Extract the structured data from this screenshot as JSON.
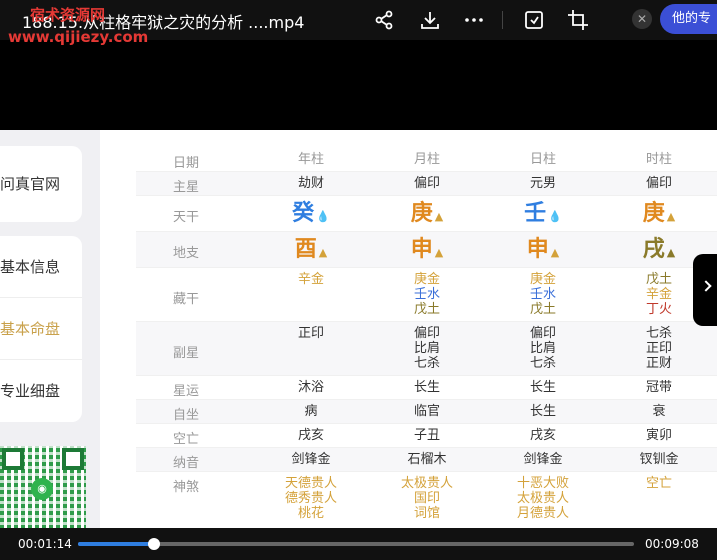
{
  "header": {
    "title": "188.15.从柱格牢狱之灾的分析 ....mp4",
    "watermark_cn": "宿术资源网",
    "watermark_url": "www.qijiezy.com",
    "his_label": "他的专"
  },
  "sidebar": {
    "card1": "问真官网",
    "card2_items": [
      "基本信息",
      "基本命盘",
      "专业细盘"
    ],
    "qr_icon": "wechat-icon"
  },
  "table": {
    "columns": [
      "日期",
      "年柱",
      "月柱",
      "日柱",
      "时柱"
    ],
    "zhuxing": {
      "label": "主星",
      "values": [
        "劫财",
        "偏印",
        "元男",
        "偏印"
      ]
    },
    "tiangan": {
      "label": "天干",
      "values": [
        "癸",
        "庚",
        "壬",
        "庚"
      ]
    },
    "dizhi": {
      "label": "地支",
      "values": [
        "酉",
        "申",
        "申",
        "戌"
      ]
    },
    "canggan": {
      "label": "藏干",
      "values": [
        [
          "辛金"
        ],
        [
          "庚金",
          "壬水",
          "戊土"
        ],
        [
          "庚金",
          "壬水",
          "戊土"
        ],
        [
          "戊土",
          "辛金",
          "丁火"
        ]
      ]
    },
    "fuxing": {
      "label": "副星",
      "values": [
        [
          "正印"
        ],
        [
          "偏印",
          "比肩",
          "七杀"
        ],
        [
          "偏印",
          "比肩",
          "七杀"
        ],
        [
          "七杀",
          "正印",
          "正财"
        ]
      ]
    },
    "xingyun": {
      "label": "星运",
      "values": [
        "沐浴",
        "长生",
        "长生",
        "冠带"
      ]
    },
    "zizuo": {
      "label": "自坐",
      "values": [
        "病",
        "临官",
        "长生",
        "衰"
      ]
    },
    "kongwang": {
      "label": "空亡",
      "values": [
        "戌亥",
        "子丑",
        "戌亥",
        "寅卯"
      ]
    },
    "nayin": {
      "label": "纳音",
      "values": [
        "剑锋金",
        "石榴木",
        "剑锋金",
        "钗钏金"
      ]
    },
    "shensha": {
      "label": "神煞",
      "values": [
        [
          "天德贵人",
          "德秀贵人",
          "桃花"
        ],
        [
          "太极贵人",
          "国印",
          "词馆"
        ],
        [
          "十恶大败",
          "太极贵人",
          "月德贵人"
        ],
        [
          "空亡"
        ]
      ]
    }
  },
  "player": {
    "current_time": "00:01:14",
    "total_time": "00:09:08",
    "progress": 0.136
  },
  "colors": {
    "accent": "#2f7ee0",
    "sidebar_active": "#c9a14b",
    "his_pill": "#3b4fd6"
  }
}
